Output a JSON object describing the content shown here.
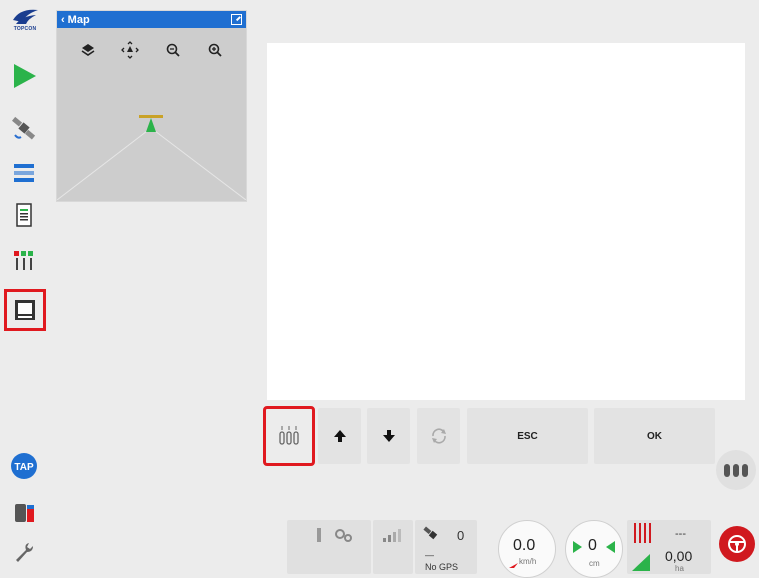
{
  "sidebar": {
    "logo_text": "TOPCON",
    "items": [
      {
        "icon": "guidance-arrow-icon"
      },
      {
        "icon": "satellite-icon"
      },
      {
        "icon": "implement-list-icon"
      },
      {
        "icon": "task-document-icon"
      },
      {
        "icon": "sections-icon"
      },
      {
        "icon": "screen-layout-icon",
        "selected": true
      },
      {
        "icon": "tap-icon",
        "label": "TAP"
      },
      {
        "icon": "tank-icon"
      },
      {
        "icon": "wrench-icon"
      }
    ]
  },
  "map": {
    "title": "Map",
    "tools": [
      "layers-icon",
      "pan-icon",
      "zoom-out-icon",
      "zoom-in-icon"
    ]
  },
  "keys": {
    "esc_label": "ESC",
    "ok_label": "OK"
  },
  "status": {
    "satellites": "0",
    "gps_status": "No GPS",
    "gps_accuracy": "—",
    "speed_value": "0.0",
    "speed_unit": "km/h",
    "offset_value": "0",
    "offset_unit": "cm",
    "sections_value": "---",
    "area_value": "0,00",
    "area_unit": "ha"
  },
  "colors": {
    "accent_blue": "#1f6fd1",
    "selection_red": "#e0191f",
    "guidance_green": "#2bb34a"
  }
}
